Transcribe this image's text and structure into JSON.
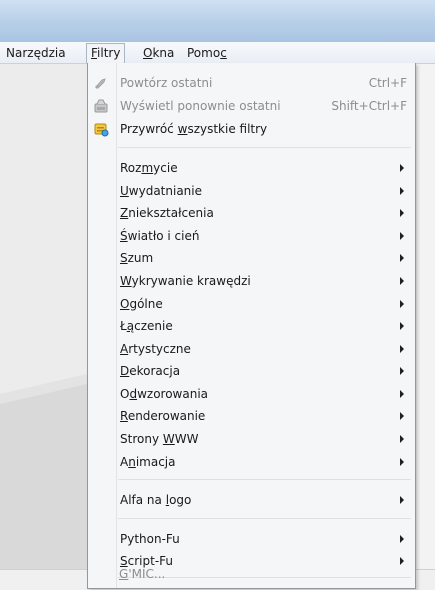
{
  "menubar": {
    "items": [
      {
        "label": "Narzędzia",
        "u": ""
      },
      {
        "label": "Filtry",
        "u": "F"
      },
      {
        "label": "Okna",
        "u": "O"
      },
      {
        "label": "Pomoc",
        "u": "c"
      }
    ]
  },
  "filters_menu": {
    "top": [
      {
        "label": "Powtórz ostatni",
        "shortcut": "Ctrl+F",
        "enabled": false,
        "icon": "repeat-icon"
      },
      {
        "label": "Wyświetl ponownie ostatni",
        "shortcut": "Shift+Ctrl+F",
        "enabled": false,
        "icon": "reshow-icon"
      },
      {
        "label": "Przywróć wszystkie filtry",
        "shortcut": "",
        "enabled": true,
        "icon": "reset-filters-icon"
      }
    ],
    "categories": [
      "Rozmycie",
      "Uwydatnianie",
      "Zniekształcenia",
      "Światło i cień",
      "Szum",
      "Wykrywanie krawędzi",
      "Ogólne",
      "Łączenie",
      "Artystyczne",
      "Dekoracja",
      "Odwzorowania",
      "Renderowanie",
      "Strony WWW",
      "Animacja"
    ],
    "logo": "Alfa na logo",
    "scripts": [
      "Python-Fu",
      "Script-Fu"
    ],
    "gmic": "G'MIC..."
  }
}
